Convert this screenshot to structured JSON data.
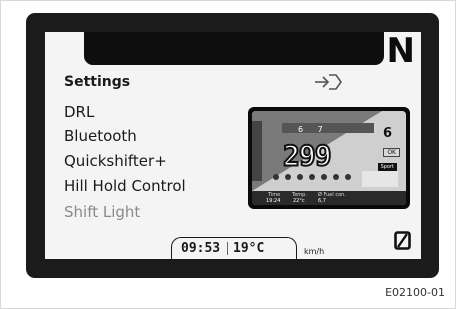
{
  "display": {
    "gear_indicator": "N",
    "menu": {
      "title": "Settings",
      "items": [
        {
          "label": "DRL",
          "state": "normal"
        },
        {
          "label": "Bluetooth",
          "state": "normal"
        },
        {
          "label": "Quickshifter+",
          "state": "normal"
        },
        {
          "label": "Hill Hold Control",
          "state": "normal"
        },
        {
          "label": "Shift Light",
          "state": "dimmed"
        }
      ],
      "enter_icon": "enter-arrow-icon"
    },
    "preview": {
      "speed": "299",
      "rpm_marks": "6 7",
      "gear": "6",
      "badge": "OK",
      "mode": "Sport",
      "info_labels": [
        "Time",
        "Temp.",
        "Ø Fuel con."
      ],
      "info_values": [
        "19:24",
        "22°c",
        "6,7"
      ]
    },
    "status": {
      "time": "09:53",
      "temperature": "19°C",
      "speed_unit": "km/h"
    },
    "corner_icon": "slashed-zero-icon"
  },
  "caption": "E02100-01",
  "colors": {
    "bezel": "#1b1b1b",
    "screen": "#f4f4f4",
    "text": "#1a1a1a",
    "dimmed_text": "#8a8a8a"
  }
}
